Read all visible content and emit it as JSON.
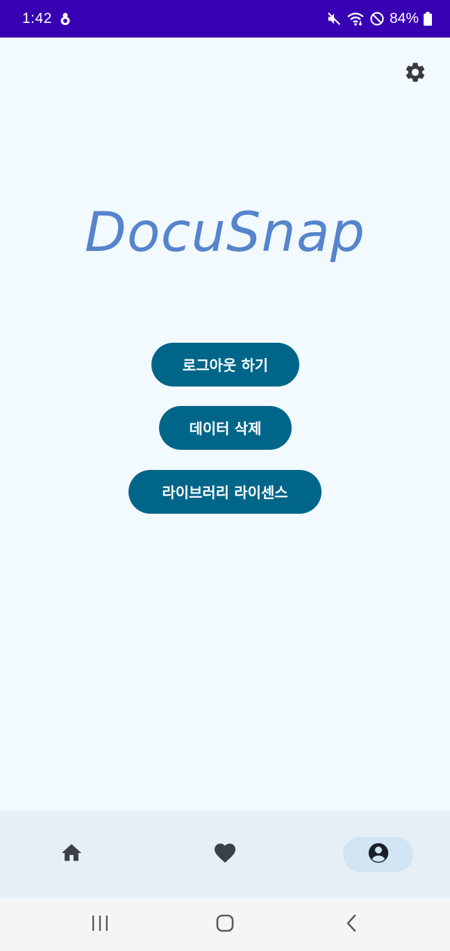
{
  "status_bar": {
    "time": "1:42",
    "battery": "84%",
    "icons": [
      "notification-app-icon",
      "mute-icon",
      "wifi-icon",
      "do-not-disturb-icon",
      "battery-icon"
    ],
    "background": "#3700b3"
  },
  "app": {
    "logo_text": "DocuSnap",
    "logo_color": "#5684cd",
    "background": "#f2faff",
    "settings_icon": "gear-icon"
  },
  "buttons": {
    "logout_label": "로그아웃 하기",
    "delete_data_label": "데이터 삭제",
    "library_license_label": "라이브러리 라이센스",
    "color": "#006689"
  },
  "bottom_nav": {
    "items": [
      {
        "icon": "home-icon",
        "selected": false
      },
      {
        "icon": "heart-icon",
        "selected": false
      },
      {
        "icon": "profile-icon",
        "selected": true
      }
    ],
    "background": "#e6eef6",
    "selected_pill": "#d0e4f4"
  },
  "system_nav": {
    "icons": [
      "recents-icon",
      "home-circle-icon",
      "back-icon"
    ]
  }
}
